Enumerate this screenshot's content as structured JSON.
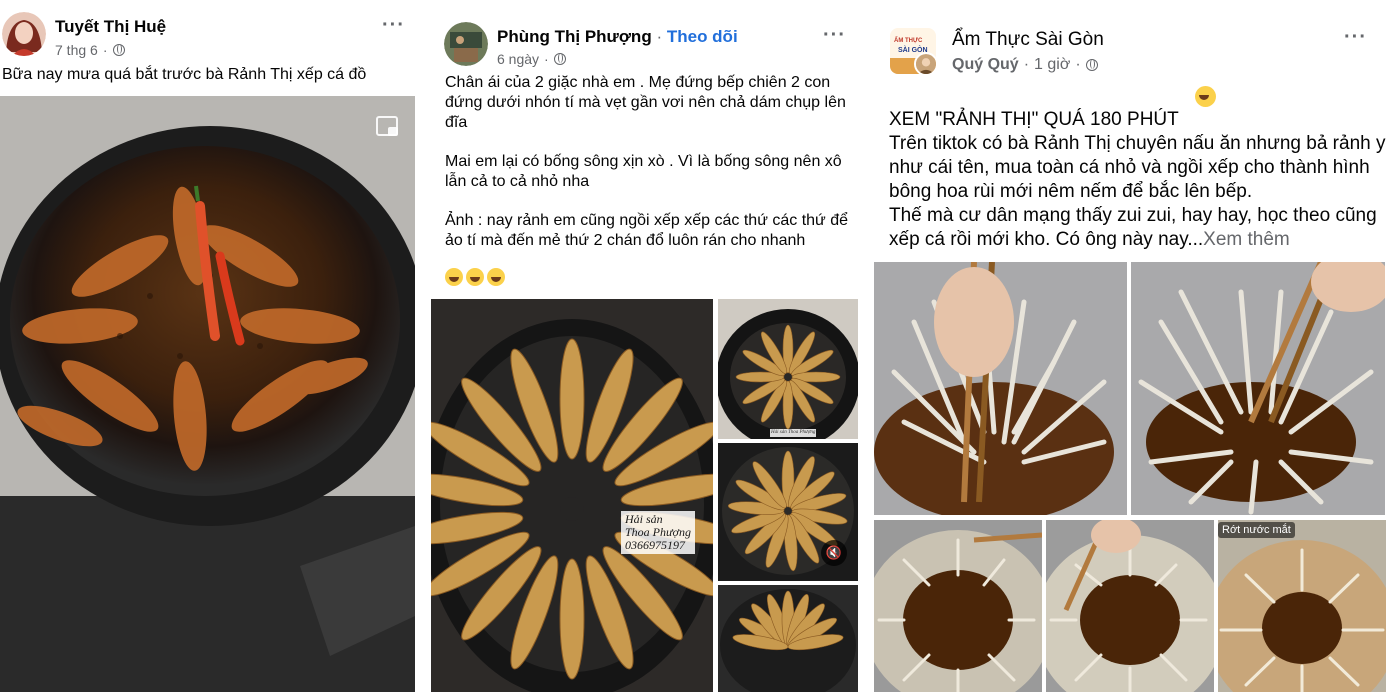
{
  "posts": [
    {
      "author": "Tuyết Thị Huệ",
      "time": "7 thg 6",
      "separator": "·",
      "text": "Bữa nay mưa quá bắt trước bà Rảnh Thị xếp cá đồ"
    },
    {
      "author": "Phùng Thị Phượng",
      "separator": "·",
      "follow": "Theo dõi",
      "time": "6 ngày",
      "paragraph1": "Chân ái của 2 giặc nhà em . Mẹ đứng bếp chiên 2 con đứng dưới nhón tí mà vẹt gần vơi nên chả dám chụp lên đĩa",
      "paragraph2": "Mai em lại có bống sông xịn xò . Vì là bống sông nên xô lẫn cả to cả nhỏ nha",
      "paragraph3": "Ảnh : nay rảnh em cũng ngồi xếp xếp các thứ các thứ để ảo tí mà đến mẻ thứ 2 chán đổ luôn rán cho nhanh",
      "photo_caption": "Hải sản\nThoa Phượng\n0366975197",
      "small_caption": "Hải sản Thoa Phượng"
    },
    {
      "author": "Ẩm Thực Sài Gòn",
      "sub_author": "Quý Quý",
      "separator": "·",
      "time": "1 giờ",
      "avatar_text": "ẨM THỰC\nSÀI GÒN",
      "text": "XEM \"RẢNH THỊ\" QUÁ 180 PHÚT \nTrên tiktok có bà Rảnh Thị chuyên nấu ăn nhưng bả rảnh y như cái tên, mua toàn cá nhỏ và ngồi xếp cho thành hình bông hoa rùi mới nêm nếm để bắc lên bếp.\nThế mà cư dân mạng thấy zui zui, hay hay, học theo cũng xếp cá rồi mới kho. Có ông này nay...",
      "see_more": "Xem thêm",
      "photo_label": "Rớt nước mắt"
    }
  ],
  "icons": [
    "more-options-icon",
    "globe-icon",
    "expand-icon",
    "mute-icon",
    "laughing-emoji",
    "smile-emoji"
  ]
}
